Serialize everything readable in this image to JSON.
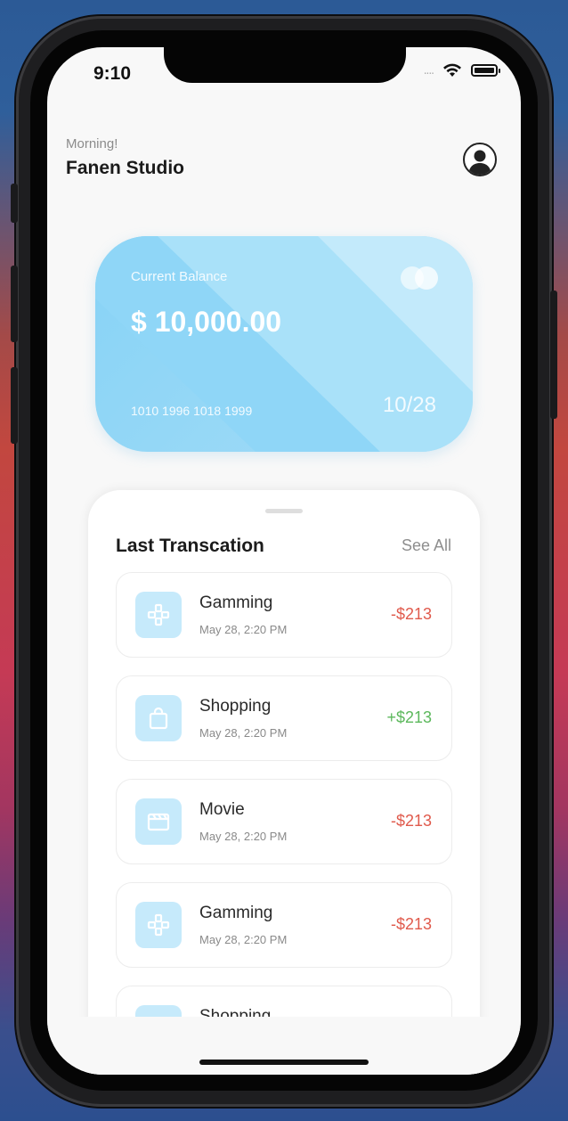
{
  "status_bar": {
    "time": "9:10",
    "signal": "....",
    "wifi_icon": "wifi-icon",
    "battery_icon": "battery-icon"
  },
  "header": {
    "greeting": "Morning!",
    "user_name": "Fanen Studio",
    "avatar_icon": "user-avatar-icon"
  },
  "card": {
    "label": "Current Balance",
    "balance": "$ 10,000.00",
    "number": "1010 1996 1018 1999",
    "expiry": "10/28",
    "logo_icon": "card-brand-icon",
    "colors": {
      "start": "#87d3f6",
      "end": "#a4dcf7"
    }
  },
  "transactions": {
    "title": "Last Transcation",
    "see_all": "See All",
    "items": [
      {
        "name": "Gamming",
        "date": "May 28, 2:20 PM",
        "amount": "-$213",
        "type": "negative",
        "icon": "gamepad-icon"
      },
      {
        "name": "Shopping",
        "date": "May 28, 2:20 PM",
        "amount": "+$213",
        "type": "positive",
        "icon": "shopping-bag-icon"
      },
      {
        "name": "Movie",
        "date": "May 28, 2:20 PM",
        "amount": "-$213",
        "type": "negative",
        "icon": "movie-clapper-icon"
      },
      {
        "name": "Gamming",
        "date": "May 28, 2:20 PM",
        "amount": "-$213",
        "type": "negative",
        "icon": "gamepad-icon"
      },
      {
        "name": "Shopping",
        "date": "",
        "amount": "",
        "type": "positive",
        "icon": "shopping-bag-icon"
      }
    ]
  },
  "colors": {
    "negative": "#e05a4c",
    "positive": "#5cb85c",
    "icon_bg": "#c6eafb",
    "icon_fg": "#7fcdf2"
  }
}
